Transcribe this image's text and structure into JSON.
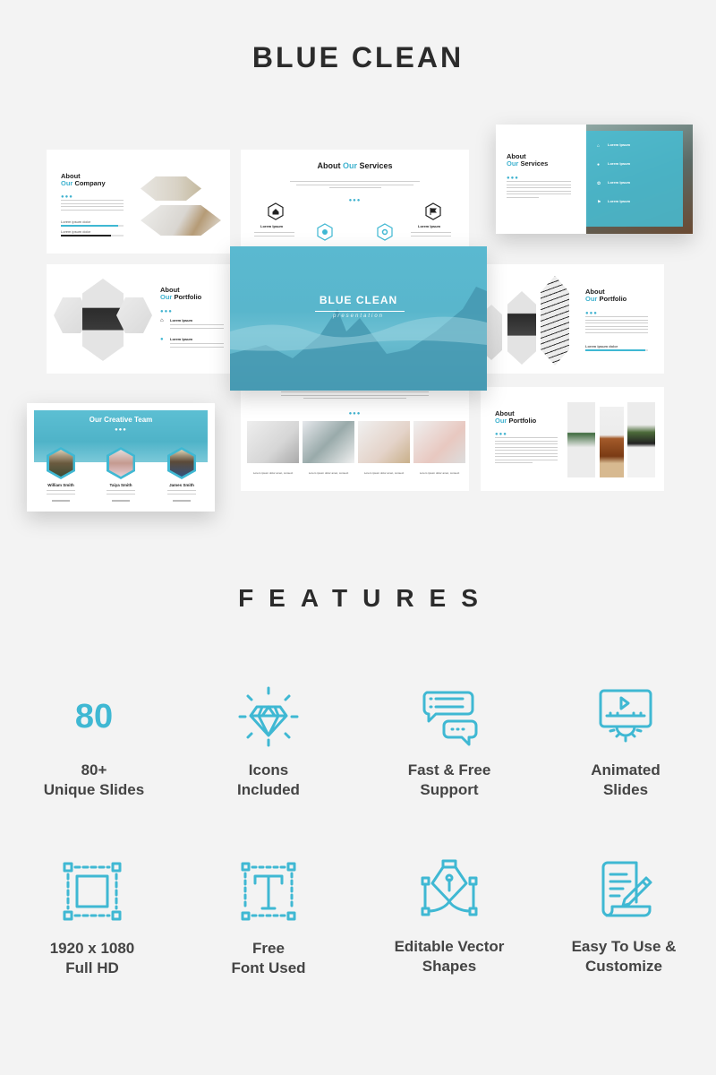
{
  "header": {
    "title": "BLUE CLEAN"
  },
  "colors": {
    "accent": "#3fb8d3",
    "background": "#f3f3f3",
    "heading": "#2b2b2b"
  },
  "slides": {
    "about_company": {
      "title_line1": "About",
      "title_accent": "Our",
      "title_rest": "Company",
      "bars": [
        {
          "label": "Lorem ipsum dolor",
          "value": 91
        },
        {
          "label": "Lorem ipsum dolor",
          "value": 80
        }
      ]
    },
    "about_services_center": {
      "title_pre": "About",
      "title_accent": "Our",
      "title_rest": "Services",
      "items": [
        {
          "icon": "home-icon",
          "label": "Lorem Ipsum"
        },
        {
          "icon": "brush-icon",
          "label": ""
        },
        {
          "icon": "gear-icon",
          "label": ""
        },
        {
          "icon": "flag-icon",
          "label": "Lorem Ipsum"
        }
      ]
    },
    "about_services_right": {
      "title_line1": "About",
      "title_accent": "Our",
      "title_rest": "Services",
      "items": [
        {
          "icon": "home-icon",
          "label": "Lorem Ipsum"
        },
        {
          "icon": "brush-icon",
          "label": "Lorem Ipsum"
        },
        {
          "icon": "gear-icon",
          "label": "Lorem Ipsum"
        },
        {
          "icon": "flag-icon",
          "label": "Lorem Ipsum"
        }
      ]
    },
    "about_portfolio_left": {
      "title_line1": "About",
      "title_accent": "Our",
      "title_rest": "Portfolio",
      "items": [
        {
          "icon": "home-icon",
          "label": "Lorem Ipsum"
        },
        {
          "icon": "brush-icon",
          "label": "Lorem Ipsum"
        }
      ]
    },
    "cover": {
      "title": "BLUE CLEAN",
      "subtitle": "presentation"
    },
    "about_portfolio_right": {
      "title_line1": "About",
      "title_accent": "Our",
      "title_rest": "Portfolio",
      "bar": {
        "label": "Lorem ipsum dolor",
        "value": 95
      }
    },
    "team": {
      "title": "Our Creative Team",
      "members": [
        {
          "name": "William Smith"
        },
        {
          "name": "Taiya Smith"
        },
        {
          "name": "James Smith"
        }
      ]
    },
    "gallery": {
      "captions": [
        "Lorem ipsum dolor amet, consect",
        "Lorem ipsum dolor amet, consect",
        "Lorem ipsum dolor amet, consect",
        "Lorem ipsum dolor amet, consect"
      ]
    },
    "about_portfolio_bottom": {
      "title_line1": "About",
      "title_accent": "Our",
      "title_rest": "Portfolio"
    }
  },
  "features": {
    "title": "FEATURES",
    "items": [
      {
        "icon": "number-80",
        "big_text": "80",
        "line1": "80+",
        "line2": "Unique Slides"
      },
      {
        "icon": "diamond-icon",
        "line1": "Icons",
        "line2": "Included"
      },
      {
        "icon": "chat-bubbles-icon",
        "line1": "Fast & Free",
        "line2": "Support"
      },
      {
        "icon": "animated-slides-icon",
        "line1": "Animated",
        "line2": "Slides"
      },
      {
        "icon": "resolution-frame-icon",
        "line1": "1920 x 1080",
        "line2": "Full HD"
      },
      {
        "icon": "font-icon",
        "line1": "Free",
        "line2": "Font Used"
      },
      {
        "icon": "pen-tool-icon",
        "line1": "Editable Vector",
        "line2": "Shapes"
      },
      {
        "icon": "document-edit-icon",
        "line1": "Easy To Use &",
        "line2": "Customize"
      }
    ]
  }
}
